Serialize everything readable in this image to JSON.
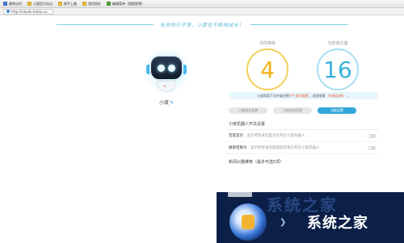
{
  "browser": {
    "bookmarks": [
      {
        "label": "最常访问",
        "icon": "star-icon"
      },
      {
        "label": "火狐官方站点",
        "icon": "folder-icon"
      },
      {
        "label": "新手上路",
        "icon": "folder-icon"
      },
      {
        "label": "常用网址",
        "icon": "folder-icon"
      },
      {
        "label": "编辑菜单（搜狐视频）",
        "icon": "folder-icon"
      }
    ],
    "url": "http://xiaodu.baidu.co..."
  },
  "header": {
    "slogan": "有你的日子里，小度在不断地成长！"
  },
  "robot": {
    "name": "小度"
  },
  "stats": {
    "current_level_label": "当前等级",
    "current_level": "4",
    "current_growth_label": "当前成长值",
    "current_growth": "16"
  },
  "upgrade_bar": {
    "prefix": "小度距离下次升级还需",
    "highlight": "9个成长值哦",
    "middle": "，速速查看",
    "link": "《升级宝典》"
  },
  "tabs": [
    {
      "label": "小度成长宝典",
      "active": false
    },
    {
      "label": "小度成长历程",
      "active": false
    },
    {
      "label": "功能设置",
      "active": true
    }
  ],
  "settings": {
    "section_title": "小度机器人开关设置",
    "rows": [
      {
        "name": "百度首页",
        "desc": "：显示所登录百度首页开启小度机器人"
      },
      {
        "name": "搜索结果页",
        "desc": "：显示所登录百度搜索结果页开启小度机器人"
      }
    ],
    "news_title": "新闻兴趣推荐（最多可选5项）"
  },
  "watermark": {
    "ghost_text": "系统之家",
    "brand_text": "系统之家"
  },
  "colors": {
    "accent": "#33a6d9",
    "level": "#f0b417",
    "growth": "#3ab2db",
    "highlight": "#f05a28"
  }
}
